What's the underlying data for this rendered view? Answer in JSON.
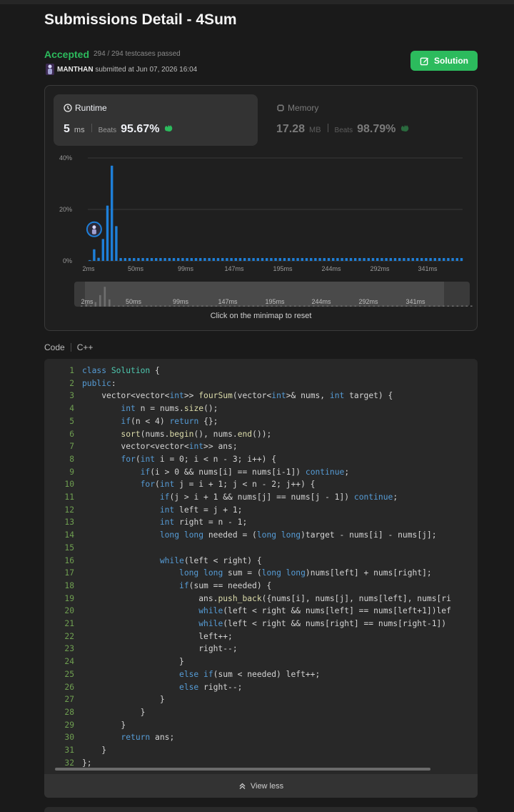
{
  "header": {
    "title": "Submissions Detail - 4Sum",
    "status": "Accepted",
    "testcases": "294 / 294 testcases passed",
    "user": "MANTHAN",
    "submitted_text": "submitted at Jun 07, 2026 16:04",
    "solution_label": "Solution"
  },
  "runtime": {
    "label": "Runtime",
    "value": "5",
    "unit": "ms",
    "beats_label": "Beats",
    "percent": "95.67%"
  },
  "memory": {
    "label": "Memory",
    "value": "17.28",
    "unit": "MB",
    "beats_label": "Beats",
    "percent": "98.79%"
  },
  "chart_data": {
    "type": "bar",
    "ylabel_ticks": [
      "40%",
      "20%",
      "0%"
    ],
    "ylim": [
      0,
      40
    ],
    "x_ticks": [
      "2ms",
      "50ms",
      "99ms",
      "147ms",
      "195ms",
      "244ms",
      "292ms",
      "341ms"
    ],
    "minimap_ticks": [
      "2ms",
      "50ms",
      "99ms",
      "147ms",
      "195ms",
      "244ms",
      "292ms",
      "341ms"
    ],
    "highlight_index": 1,
    "values": [
      0.3,
      4.5,
      1.2,
      8.5,
      21.5,
      37,
      13.5,
      1.1,
      1.1,
      1.1,
      1.1,
      1.1,
      1.1,
      1.1,
      1.1,
      1.1,
      1.1,
      1.1,
      1.1,
      1.1,
      1.1,
      1.1,
      1.1,
      1.1,
      1.1,
      1.1,
      1.1,
      1.1,
      1.1,
      1.1,
      1.1,
      1.1,
      1.1,
      1.1,
      1.1,
      1.1,
      1.1,
      1.1,
      1.1,
      1.1,
      1.1,
      1.1,
      1.1,
      1.1,
      1.1,
      1.1,
      1.1,
      1.1,
      1.1,
      1.1,
      1.1,
      1.1,
      1.1,
      1.1,
      1.1,
      1.1,
      1.1,
      1.1,
      1.1,
      1.1,
      1.1,
      1.1,
      1.1,
      1.1,
      1.1,
      1.1,
      1.1,
      1.1,
      1.1,
      1.1,
      1.1,
      1.1,
      1.1,
      1.1,
      1.1,
      1.1,
      1.1,
      1.1,
      1.1,
      1.1,
      1.1,
      1.1,
      1.1,
      1.1,
      1.1
    ]
  },
  "minimap_note": "Click on the minimap to reset",
  "code": {
    "label": "Code",
    "language": "C++",
    "view_less_label": "View less",
    "lines": [
      [
        [
          "class ",
          "kw"
        ],
        [
          "Solution ",
          "ty"
        ],
        [
          "{",
          ""
        ]
      ],
      [
        [
          "public",
          "kw"
        ],
        [
          ":",
          ""
        ]
      ],
      [
        [
          "    vector<vector<",
          ""
        ],
        [
          "int",
          "kw"
        ],
        [
          ">> ",
          ""
        ],
        [
          "fourSum",
          "fn"
        ],
        [
          "(vector<",
          ""
        ],
        [
          "int",
          "kw"
        ],
        [
          ">& nums, ",
          ""
        ],
        [
          "int",
          "kw"
        ],
        [
          " target) {",
          ""
        ]
      ],
      [
        [
          "        ",
          ""
        ],
        [
          "int",
          "kw"
        ],
        [
          " n = nums.",
          ""
        ],
        [
          "size",
          "fn"
        ],
        [
          "();",
          ""
        ]
      ],
      [
        [
          "        ",
          ""
        ],
        [
          "if",
          "kw"
        ],
        [
          "(n < 4) ",
          ""
        ],
        [
          "return",
          "kw"
        ],
        [
          " {};",
          ""
        ]
      ],
      [
        [
          "        ",
          ""
        ],
        [
          "sort",
          "fn"
        ],
        [
          "(nums.",
          ""
        ],
        [
          "begin",
          "fn"
        ],
        [
          "(), nums.",
          ""
        ],
        [
          "end",
          "fn"
        ],
        [
          "());",
          ""
        ]
      ],
      [
        [
          "        vector<vector<",
          ""
        ],
        [
          "int",
          "kw"
        ],
        [
          ">> ans;",
          ""
        ]
      ],
      [
        [
          "        ",
          ""
        ],
        [
          "for",
          "kw"
        ],
        [
          "(",
          ""
        ],
        [
          "int",
          "kw"
        ],
        [
          " i = 0; i < n - 3; i++) {",
          ""
        ]
      ],
      [
        [
          "            ",
          ""
        ],
        [
          "if",
          "kw"
        ],
        [
          "(i > 0 && nums[i] == nums[i-1]) ",
          ""
        ],
        [
          "continue",
          "kw"
        ],
        [
          ";",
          ""
        ]
      ],
      [
        [
          "            ",
          ""
        ],
        [
          "for",
          "kw"
        ],
        [
          "(",
          ""
        ],
        [
          "int",
          "kw"
        ],
        [
          " j = i + 1; j < n - 2; j++) {",
          ""
        ]
      ],
      [
        [
          "                ",
          ""
        ],
        [
          "if",
          "kw"
        ],
        [
          "(j > i + 1 && nums[j] == nums[j - 1]) ",
          ""
        ],
        [
          "continue",
          "kw"
        ],
        [
          ";",
          ""
        ]
      ],
      [
        [
          "                ",
          ""
        ],
        [
          "int",
          "kw"
        ],
        [
          " left = j + 1;",
          ""
        ]
      ],
      [
        [
          "                ",
          ""
        ],
        [
          "int",
          "kw"
        ],
        [
          " right = n - 1;",
          ""
        ]
      ],
      [
        [
          "                ",
          ""
        ],
        [
          "long long",
          "kw"
        ],
        [
          " needed = (",
          ""
        ],
        [
          "long long",
          "kw"
        ],
        [
          ")target - nums[i] - nums[j];",
          ""
        ]
      ],
      [
        [
          "",
          ""
        ]
      ],
      [
        [
          "                ",
          ""
        ],
        [
          "while",
          "kw"
        ],
        [
          "(left < right) {",
          ""
        ]
      ],
      [
        [
          "                    ",
          ""
        ],
        [
          "long long",
          "kw"
        ],
        [
          " sum = (",
          ""
        ],
        [
          "long long",
          "kw"
        ],
        [
          ")nums[left] + nums[right];",
          ""
        ]
      ],
      [
        [
          "                    ",
          ""
        ],
        [
          "if",
          "kw"
        ],
        [
          "(sum == needed) {",
          ""
        ]
      ],
      [
        [
          "                        ans.",
          ""
        ],
        [
          "push_back",
          "fn"
        ],
        [
          "({nums[i], nums[j], nums[left], nums[ri",
          ""
        ]
      ],
      [
        [
          "                        ",
          ""
        ],
        [
          "while",
          "kw"
        ],
        [
          "(left < right && nums[left] == nums[left+1])lef",
          ""
        ]
      ],
      [
        [
          "                        ",
          ""
        ],
        [
          "while",
          "kw"
        ],
        [
          "(left < right && nums[right] == nums[right-1])",
          ""
        ]
      ],
      [
        [
          "                        left++;",
          ""
        ]
      ],
      [
        [
          "                        right--;",
          ""
        ]
      ],
      [
        [
          "                    }",
          ""
        ]
      ],
      [
        [
          "                    ",
          ""
        ],
        [
          "else if",
          "kw"
        ],
        [
          "(sum < needed) left++;",
          ""
        ]
      ],
      [
        [
          "                    ",
          ""
        ],
        [
          "else",
          "kw"
        ],
        [
          " right--;",
          ""
        ]
      ],
      [
        [
          "                }",
          ""
        ]
      ],
      [
        [
          "            }",
          ""
        ]
      ],
      [
        [
          "        }",
          ""
        ]
      ],
      [
        [
          "        ",
          ""
        ],
        [
          "return",
          "kw"
        ],
        [
          " ans;",
          ""
        ]
      ],
      [
        [
          "    }",
          ""
        ]
      ],
      [
        [
          "};",
          ""
        ]
      ]
    ]
  },
  "colors": {
    "accent": "#2cbb5d",
    "bar": "#1e7fd8",
    "bg": "#1a1a1a"
  }
}
